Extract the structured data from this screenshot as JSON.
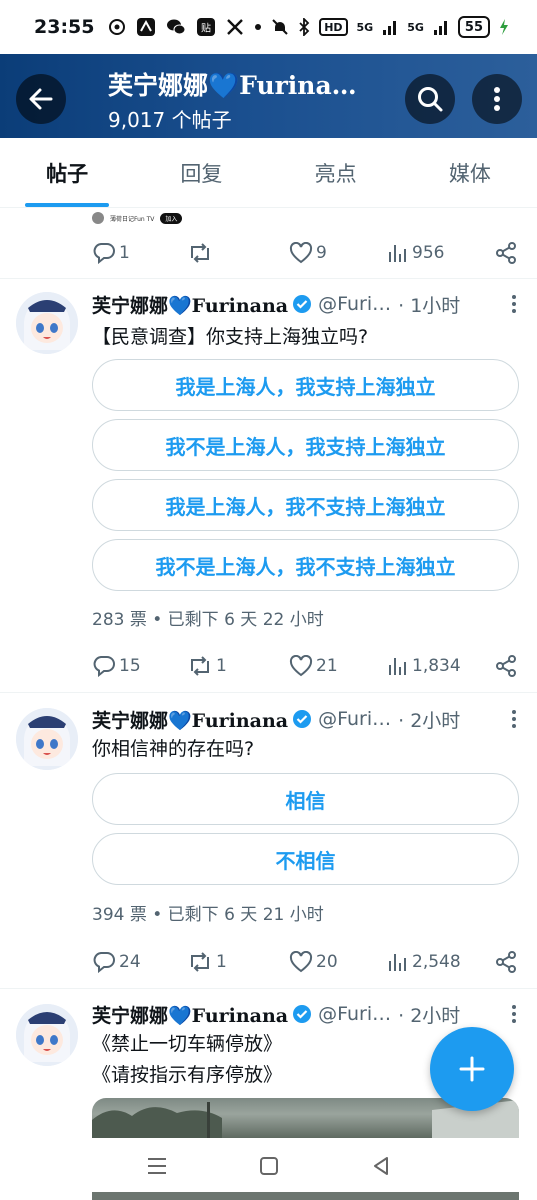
{
  "status_bar": {
    "time": "23:55",
    "network_hd": "HD",
    "sim1": "5G",
    "sim2": "5G",
    "battery": "55"
  },
  "header": {
    "title": "芙宁娜娜💙Furina…",
    "post_count": "9,017 个帖子"
  },
  "tabs": [
    {
      "label": "帖子",
      "active": true
    },
    {
      "label": "回复",
      "active": false
    },
    {
      "label": "亮点",
      "active": false
    },
    {
      "label": "媒体",
      "active": false
    }
  ],
  "partial_post": {
    "strip_name": "薄荷日记Fun TV",
    "strip_join": "加入",
    "stats": {
      "replies": "1",
      "reposts": "",
      "likes": "9",
      "views": "956"
    }
  },
  "tweets": [
    {
      "name": "芙宁娜娜💙Furinana",
      "handle": "@Furi…",
      "time": "· 1小时",
      "text": "【民意调查】你支持上海独立吗?",
      "poll_options": [
        "我是上海人，我支持上海独立",
        "我不是上海人，我支持上海独立",
        "我是上海人，我不支持上海独立",
        "我不是上海人，我不支持上海独立"
      ],
      "poll_meta": "283 票 • 已剩下 6 天 22 小时",
      "stats": {
        "replies": "15",
        "reposts": "1",
        "likes": "21",
        "views": "1,834"
      }
    },
    {
      "name": "芙宁娜娜💙Furinana",
      "handle": "@Furi…",
      "time": "· 2小时",
      "text": "你相信神的存在吗?",
      "poll_options": [
        "相信",
        "不相信"
      ],
      "poll_meta": "394 票 • 已剩下 6 天 21 小时",
      "stats": {
        "replies": "24",
        "reposts": "1",
        "likes": "20",
        "views": "2,548"
      }
    },
    {
      "name": "芙宁娜娜💙Furinana",
      "handle": "@Furi…",
      "time": "· 2小时",
      "text_lines": [
        "《禁止一切车辆停放》",
        "《请按指示有序停放》"
      ]
    }
  ],
  "colors": {
    "accent": "#1d9bf0",
    "header_bg": "#1a4f8f",
    "muted": "#536471"
  },
  "icons": {
    "back": "arrow-left-icon",
    "search": "search-icon",
    "more": "more-vertical-icon",
    "compose": "plus-icon"
  }
}
